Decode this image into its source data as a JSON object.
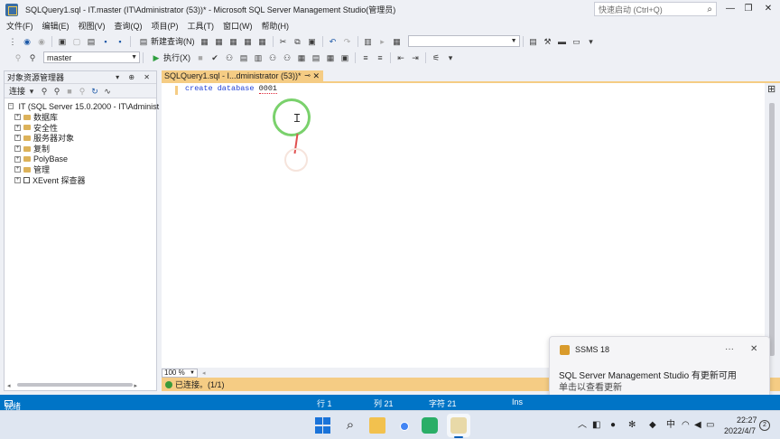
{
  "window": {
    "title": "SQLQuery1.sql - IT.master (IT\\Administrator (53))* - Microsoft SQL Server Management Studio(管理员)",
    "quick_launch_placeholder": "快速启动 (Ctrl+Q)",
    "minimize": "—",
    "maximize": "❐",
    "close": "✕"
  },
  "menu": [
    "文件(F)",
    "编辑(E)",
    "视图(V)",
    "查询(Q)",
    "项目(P)",
    "工具(T)",
    "窗口(W)",
    "帮助(H)"
  ],
  "toolbar": {
    "new_query": "新建查询(N)",
    "database_selected": "master",
    "execute": "执行(X)"
  },
  "object_explorer": {
    "title": "对象资源管理器",
    "header_buttons": "▾ ⊕ ✕",
    "connect": "连接",
    "root": "IT (SQL Server 15.0.2000 - IT\\Administ",
    "children": [
      "数据库",
      "安全性",
      "服务器对象",
      "复制",
      "PolyBase",
      "管理",
      "XEvent 探查器"
    ]
  },
  "editor": {
    "tab_title": "SQLQuery1.sql - I...dministrator (53))*",
    "tab_pin": "⊸",
    "tab_close": "✕",
    "code_keywords": "create database ",
    "code_identifier": "0001",
    "zoom": "100 %",
    "query_status": "已连接。(1/1)"
  },
  "notification": {
    "app": "SSMS 18",
    "more": "···",
    "close": "✕",
    "title": "SQL Server Management Studio 有更新可用",
    "body": "单击以查看更新"
  },
  "statusbar": {
    "ready": "就绪",
    "row": "行 1",
    "col": "列 21",
    "char": "字符 21",
    "mode": "Ins"
  },
  "taskbar": {
    "time": "22:27",
    "date": "2022/4/7"
  }
}
